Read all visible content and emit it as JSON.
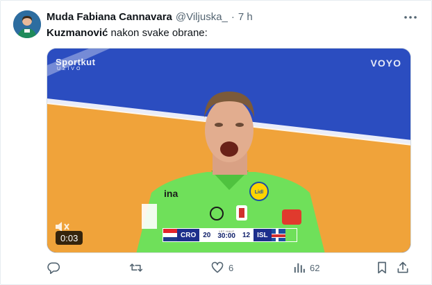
{
  "tweet": {
    "author_name": "Muda Fabiana Cannavara",
    "handle": "@Viljuska_",
    "separator": "·",
    "time": "7 h",
    "text_bold": "Kuzmanović",
    "text_rest": " nakon svake obrane:"
  },
  "media": {
    "broadcaster_logo": "Sportkut",
    "broadcaster_sub": "UŽIVO",
    "platform_logo": "VOYO",
    "duration": "0:03",
    "scoreboard": {
      "home_team": "CRO",
      "home_score": "20",
      "clock": "30:00",
      "clock_label": "1ST HALF",
      "away_team": "ISL",
      "away_score": "12"
    },
    "jersey_sponsor": "Lidl"
  },
  "actions": {
    "reply_count": "",
    "retweet_count": "",
    "like_count": "6",
    "views_count": "62"
  },
  "icons": [
    "avatar",
    "more-icon",
    "mute-icon",
    "reply-icon",
    "retweet-icon",
    "like-icon",
    "views-icon",
    "bookmark-icon",
    "share-icon"
  ],
  "colors": {
    "text_primary": "#0f1419",
    "text_secondary": "#536471",
    "court_blue": "#2b4dc0",
    "court_orange": "#f0a33a",
    "jersey_green": "#6fe05a"
  }
}
